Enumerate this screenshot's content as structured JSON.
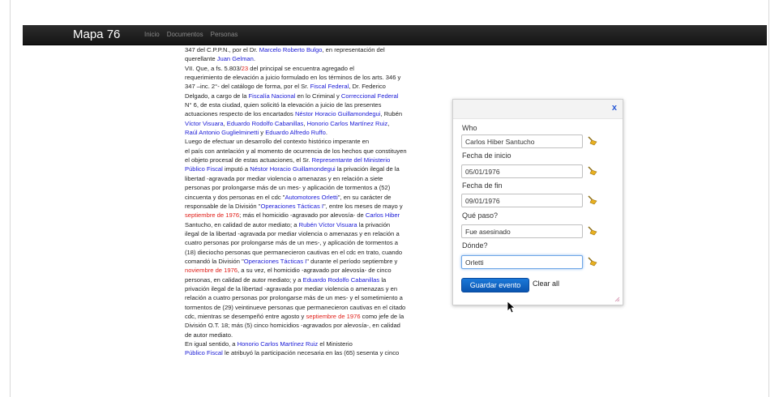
{
  "navbar": {
    "brand": "Mapa 76",
    "links": [
      "Inicio",
      "Documentos",
      "Personas"
    ]
  },
  "document": {
    "lines": [
      [
        [
          "347 del C.P.P.N., por el Dr. ",
          ""
        ],
        [
          "Marcelo Roberto Bulgo",
          "l"
        ],
        [
          ", en representación del",
          ""
        ]
      ],
      [
        [
          "querellante ",
          ""
        ],
        [
          "Juan Gelman",
          "l"
        ],
        [
          ".",
          ""
        ]
      ],
      [
        [
          "VII. Que, a fs. 5.803/",
          ""
        ],
        [
          "23",
          "d"
        ],
        [
          " del principal se encuentra agregado el",
          ""
        ]
      ],
      [
        [
          "requerimiento de elevación a juicio formulado en los términos de los arts. 346 y",
          ""
        ]
      ],
      [
        [
          "347 –inc. 2°- del catálogo de forma, por el Sr. ",
          ""
        ],
        [
          "Fiscal Federal",
          "l"
        ],
        [
          ", Dr. Federico",
          ""
        ]
      ],
      [
        [
          "Delgado, a cargo de la ",
          ""
        ],
        [
          "Fiscalía Nacional",
          "l"
        ],
        [
          " en lo Criminal y ",
          ""
        ],
        [
          "Correccional Federal",
          "l"
        ]
      ],
      [
        [
          "N° 6, de esta ciudad, quien solicitó la elevación a juicio de las presentes",
          ""
        ]
      ],
      [
        [
          "actuaciones respecto de los encartados ",
          ""
        ],
        [
          "Néstor Horacio Guillamondegui",
          "l"
        ],
        [
          ", Rubén",
          ""
        ]
      ],
      [
        [
          "Víctor Visuara",
          "l"
        ],
        [
          ", ",
          ""
        ],
        [
          "Eduardo Rodolfo Cabanillas",
          "l"
        ],
        [
          ", ",
          ""
        ],
        [
          "Honorio Carlos Martínez Ruiz",
          "l"
        ],
        [
          ",",
          ""
        ]
      ],
      [
        [
          "Raúl Antonio Guglielminetti",
          "l"
        ],
        [
          " y ",
          ""
        ],
        [
          "Eduardo Alfredo Ruffo",
          "l"
        ],
        [
          ".",
          ""
        ]
      ],
      [
        [
          "Luego de efectuar un desarrollo del contexto histórico imperante en",
          ""
        ]
      ],
      [
        [
          "el país con antelación y al momento de ocurrencia de los hechos que constituyen",
          ""
        ]
      ],
      [
        [
          "el objeto procesal de estas actuaciones, el Sr. ",
          ""
        ],
        [
          "Representante del Ministerio",
          "l"
        ]
      ],
      [
        [
          "Público Fiscal",
          "l"
        ],
        [
          " imputó a ",
          ""
        ],
        [
          "Néstor Horacio Guillamondegui",
          "l"
        ],
        [
          " la privación ilegal de la",
          ""
        ]
      ],
      [
        [
          "libertad -agravada por mediar violencia o amenazas y en relación a siete",
          ""
        ]
      ],
      [
        [
          "personas por prolongarse más de un mes- y aplicación de tormentos a (52)",
          ""
        ]
      ],
      [
        [
          "cincuenta y dos personas en el cdc \"",
          ""
        ],
        [
          "Automotores Orletti",
          "l"
        ],
        [
          "\", en su carácter de",
          ""
        ]
      ],
      [
        [
          "responsable de la División \"",
          ""
        ],
        [
          "Operaciones Tácticas I",
          "l"
        ],
        [
          "\", entre los meses de mayo y",
          ""
        ]
      ],
      [
        [
          "septiembre de 1976",
          "d"
        ],
        [
          "; más el homicidio -agravado por alevosía- de ",
          ""
        ],
        [
          "Carlos Hiber",
          "l"
        ]
      ],
      [
        [
          "Santucho, en calidad de autor mediato; a ",
          ""
        ],
        [
          "Rubén Víctor Visuara",
          "l"
        ],
        [
          " la privación",
          ""
        ]
      ],
      [
        [
          "ilegal de la libertad -agravada por mediar violencia o amenazas y en relación a",
          ""
        ]
      ],
      [
        [
          "cuatro personas por prolongarse más de un mes-, y aplicación de tormentos a",
          ""
        ]
      ],
      [
        [
          "(18) dieciocho personas que permanecieron cautivas en el cdc en trato, cuando",
          ""
        ]
      ],
      [
        [
          "comandó la División \"",
          ""
        ],
        [
          "Operaciones Tácticas I",
          "l"
        ],
        [
          "\" durante el período septiembre y",
          ""
        ]
      ],
      [
        [
          "noviembre de 1976",
          "d"
        ],
        [
          ", a su vez, el homicidio -agravado por alevosía- de cinco",
          ""
        ]
      ],
      [
        [
          "personas, en calidad de autor mediato; y a ",
          ""
        ],
        [
          "Eduardo Rodolfo Cabanillas",
          "l"
        ],
        [
          " la",
          ""
        ]
      ],
      [
        [
          "privación ilegal de la libertad -agravada por mediar violencia o amenazas y en",
          ""
        ]
      ],
      [
        [
          "relación a cuatro personas por prolongarse más de un mes- y el sometimiento a",
          ""
        ]
      ],
      [
        [
          "tormentos de (29) veintinueve personas que permanecieron cautivas en el citado",
          ""
        ]
      ],
      [
        [
          "cdc, mientras se desempeñó entre agosto y ",
          ""
        ],
        [
          "septiembre de 1976",
          "d"
        ],
        [
          " como jefe de la",
          ""
        ]
      ],
      [
        [
          "División O.T. 18; más (5) cinco homicidios -agravados por alevosía-, en calidad",
          ""
        ]
      ],
      [
        [
          "de autor mediato.",
          ""
        ]
      ],
      [
        [
          "En igual sentido, a ",
          ""
        ],
        [
          "Honorio Carlos Martínez Ruiz",
          "l"
        ],
        [
          " el Ministerio",
          ""
        ]
      ],
      [
        [
          "Público Fiscal",
          "l"
        ],
        [
          " le atribuyó la participación necesaria en las (65) sesenta y cinco",
          ""
        ]
      ]
    ]
  },
  "panel": {
    "close": "x",
    "fields": [
      {
        "label": "Who",
        "value": "Carlos Hiber Santucho"
      },
      {
        "label": "Fecha de inicio",
        "value": "05/01/1976"
      },
      {
        "label": "Fecha de fin",
        "value": "09/01/1976"
      },
      {
        "label": "Qué paso?",
        "value": "Fue asesinado"
      },
      {
        "label": "Dónde?",
        "value": "Orletti"
      }
    ],
    "save_label": "Guardar evento",
    "clear_label": "Clear all"
  },
  "colors": {
    "link": "#1a1ad6",
    "date": "#e0201a",
    "button": "#0a62c4",
    "navbar": "#1c1c1c"
  }
}
